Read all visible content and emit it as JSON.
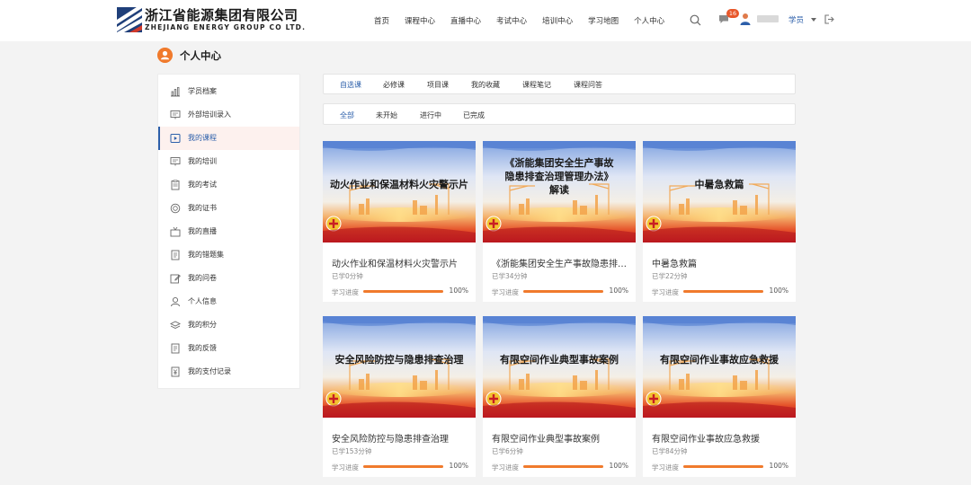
{
  "brand": {
    "name_cn": "浙江省能源集团有限公司",
    "name_en": "ZHEJIANG ENERGY GROUP CO LTD."
  },
  "nav": [
    "首页",
    "课程中心",
    "直播中心",
    "考试中心",
    "培训中心",
    "学习地图",
    "个人中心"
  ],
  "header": {
    "search_icon": "search-icon",
    "message_badge": "16",
    "role": "学员",
    "logout_icon": "logout-icon"
  },
  "page": {
    "title": "个人中心"
  },
  "sidebar": {
    "items": [
      {
        "label": "学员档案",
        "icon": "chart-icon"
      },
      {
        "label": "外部培训录入",
        "icon": "monitor-icon"
      },
      {
        "label": "我的课程",
        "icon": "play-icon",
        "active": true
      },
      {
        "label": "我的培训",
        "icon": "monitor-icon"
      },
      {
        "label": "我的考试",
        "icon": "clipboard-icon"
      },
      {
        "label": "我的证书",
        "icon": "certificate-icon"
      },
      {
        "label": "我的直播",
        "icon": "live-icon"
      },
      {
        "label": "我的错题集",
        "icon": "notebook-icon"
      },
      {
        "label": "我的问卷",
        "icon": "edit-icon"
      },
      {
        "label": "个人信息",
        "icon": "user-icon"
      },
      {
        "label": "我的积分",
        "icon": "points-icon"
      },
      {
        "label": "我的反馈",
        "icon": "feedback-icon"
      },
      {
        "label": "我的支付记录",
        "icon": "payment-icon"
      }
    ]
  },
  "tabs": {
    "primary": [
      "自选课",
      "必修课",
      "项目课",
      "我的收藏",
      "课程笔记",
      "课程问答"
    ],
    "primary_active": 0,
    "secondary": [
      "全部",
      "未开始",
      "进行中",
      "已完成"
    ],
    "secondary_active": 0
  },
  "progress_label": "学习进度",
  "courses": [
    {
      "banner": [
        "动火作业和保温材料火灾警示片"
      ],
      "title": "动火作业和保温材料火灾警示片",
      "time": "已学0分钟",
      "progress": 100,
      "progress_text": "100%"
    },
    {
      "banner": [
        "《浙能集团安全生产事故",
        "隐患排查治理管理办法》",
        "解读"
      ],
      "title": "《浙能集团安全生产事故隐患排查治理管理办法》解读",
      "time": "已学34分钟",
      "progress": 100,
      "progress_text": "100%"
    },
    {
      "banner": [
        "中暑急救篇"
      ],
      "title": "中暑急救篇",
      "time": "已学22分钟",
      "progress": 100,
      "progress_text": "100%"
    },
    {
      "banner": [
        "安全风险防控与隐患排查治理"
      ],
      "title": "安全风险防控与隐患排查治理",
      "time": "已学153分钟",
      "progress": 100,
      "progress_text": "100%"
    },
    {
      "banner": [
        "有限空间作业典型事故案例"
      ],
      "title": "有限空间作业典型事故案例",
      "time": "已学6分钟",
      "progress": 100,
      "progress_text": "100%"
    },
    {
      "banner": [
        "有限空间作业事故应急救援"
      ],
      "title": "有限空间作业事故应急救援",
      "time": "已学84分钟",
      "progress": 100,
      "progress_text": "100%"
    }
  ],
  "colors": {
    "accent_blue": "#2c5faa",
    "accent_orange": "#f07a2c",
    "badge_red": "#e8572a"
  }
}
